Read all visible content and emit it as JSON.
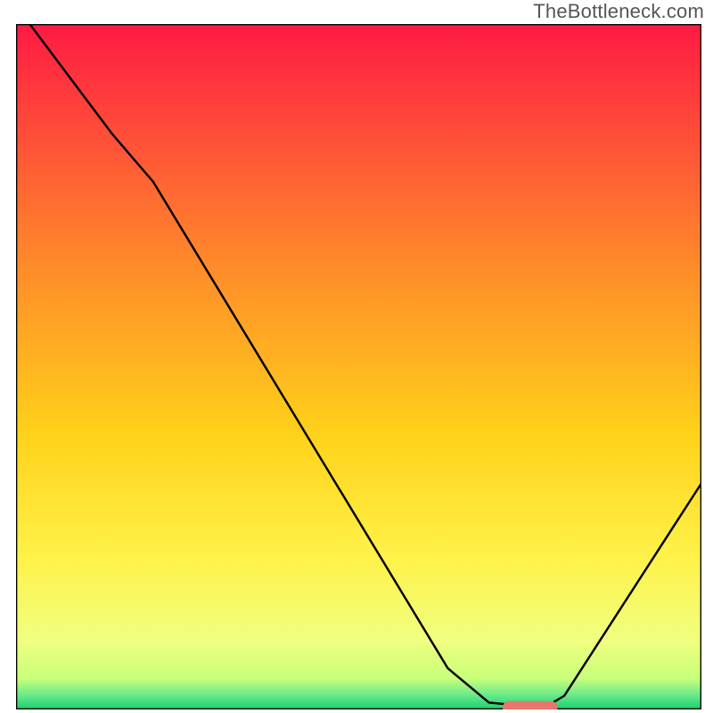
{
  "watermark": "TheBottleneck.com",
  "chart_data": {
    "type": "line",
    "title": "",
    "xlabel": "",
    "ylabel": "",
    "xlim": [
      0,
      100
    ],
    "ylim": [
      0,
      100
    ],
    "axes_visible": false,
    "background_gradient": {
      "stops": [
        {
          "offset": 0.0,
          "color": "#ff1a44"
        },
        {
          "offset": 0.35,
          "color": "#ff8a2a"
        },
        {
          "offset": 0.6,
          "color": "#ffd21a"
        },
        {
          "offset": 0.78,
          "color": "#fff24a"
        },
        {
          "offset": 0.9,
          "color": "#f0ff80"
        },
        {
          "offset": 0.955,
          "color": "#c8ff7a"
        },
        {
          "offset": 0.98,
          "color": "#66e88a"
        },
        {
          "offset": 1.0,
          "color": "#18d070"
        }
      ]
    },
    "series": [
      {
        "name": "bottleneck-curve",
        "color": "#000000",
        "stroke_width": 2.2,
        "points": [
          {
            "x": 2,
            "y": 100
          },
          {
            "x": 14,
            "y": 84
          },
          {
            "x": 20,
            "y": 77
          },
          {
            "x": 63,
            "y": 6
          },
          {
            "x": 69,
            "y": 1
          },
          {
            "x": 73,
            "y": 0.6
          },
          {
            "x": 78,
            "y": 0.8
          },
          {
            "x": 80,
            "y": 2
          },
          {
            "x": 100,
            "y": 33
          }
        ]
      }
    ],
    "marker": {
      "name": "optimal-range",
      "color": "#e8766c",
      "x_start": 71,
      "x_end": 79,
      "y": 0.3,
      "thickness": 1.8
    }
  }
}
